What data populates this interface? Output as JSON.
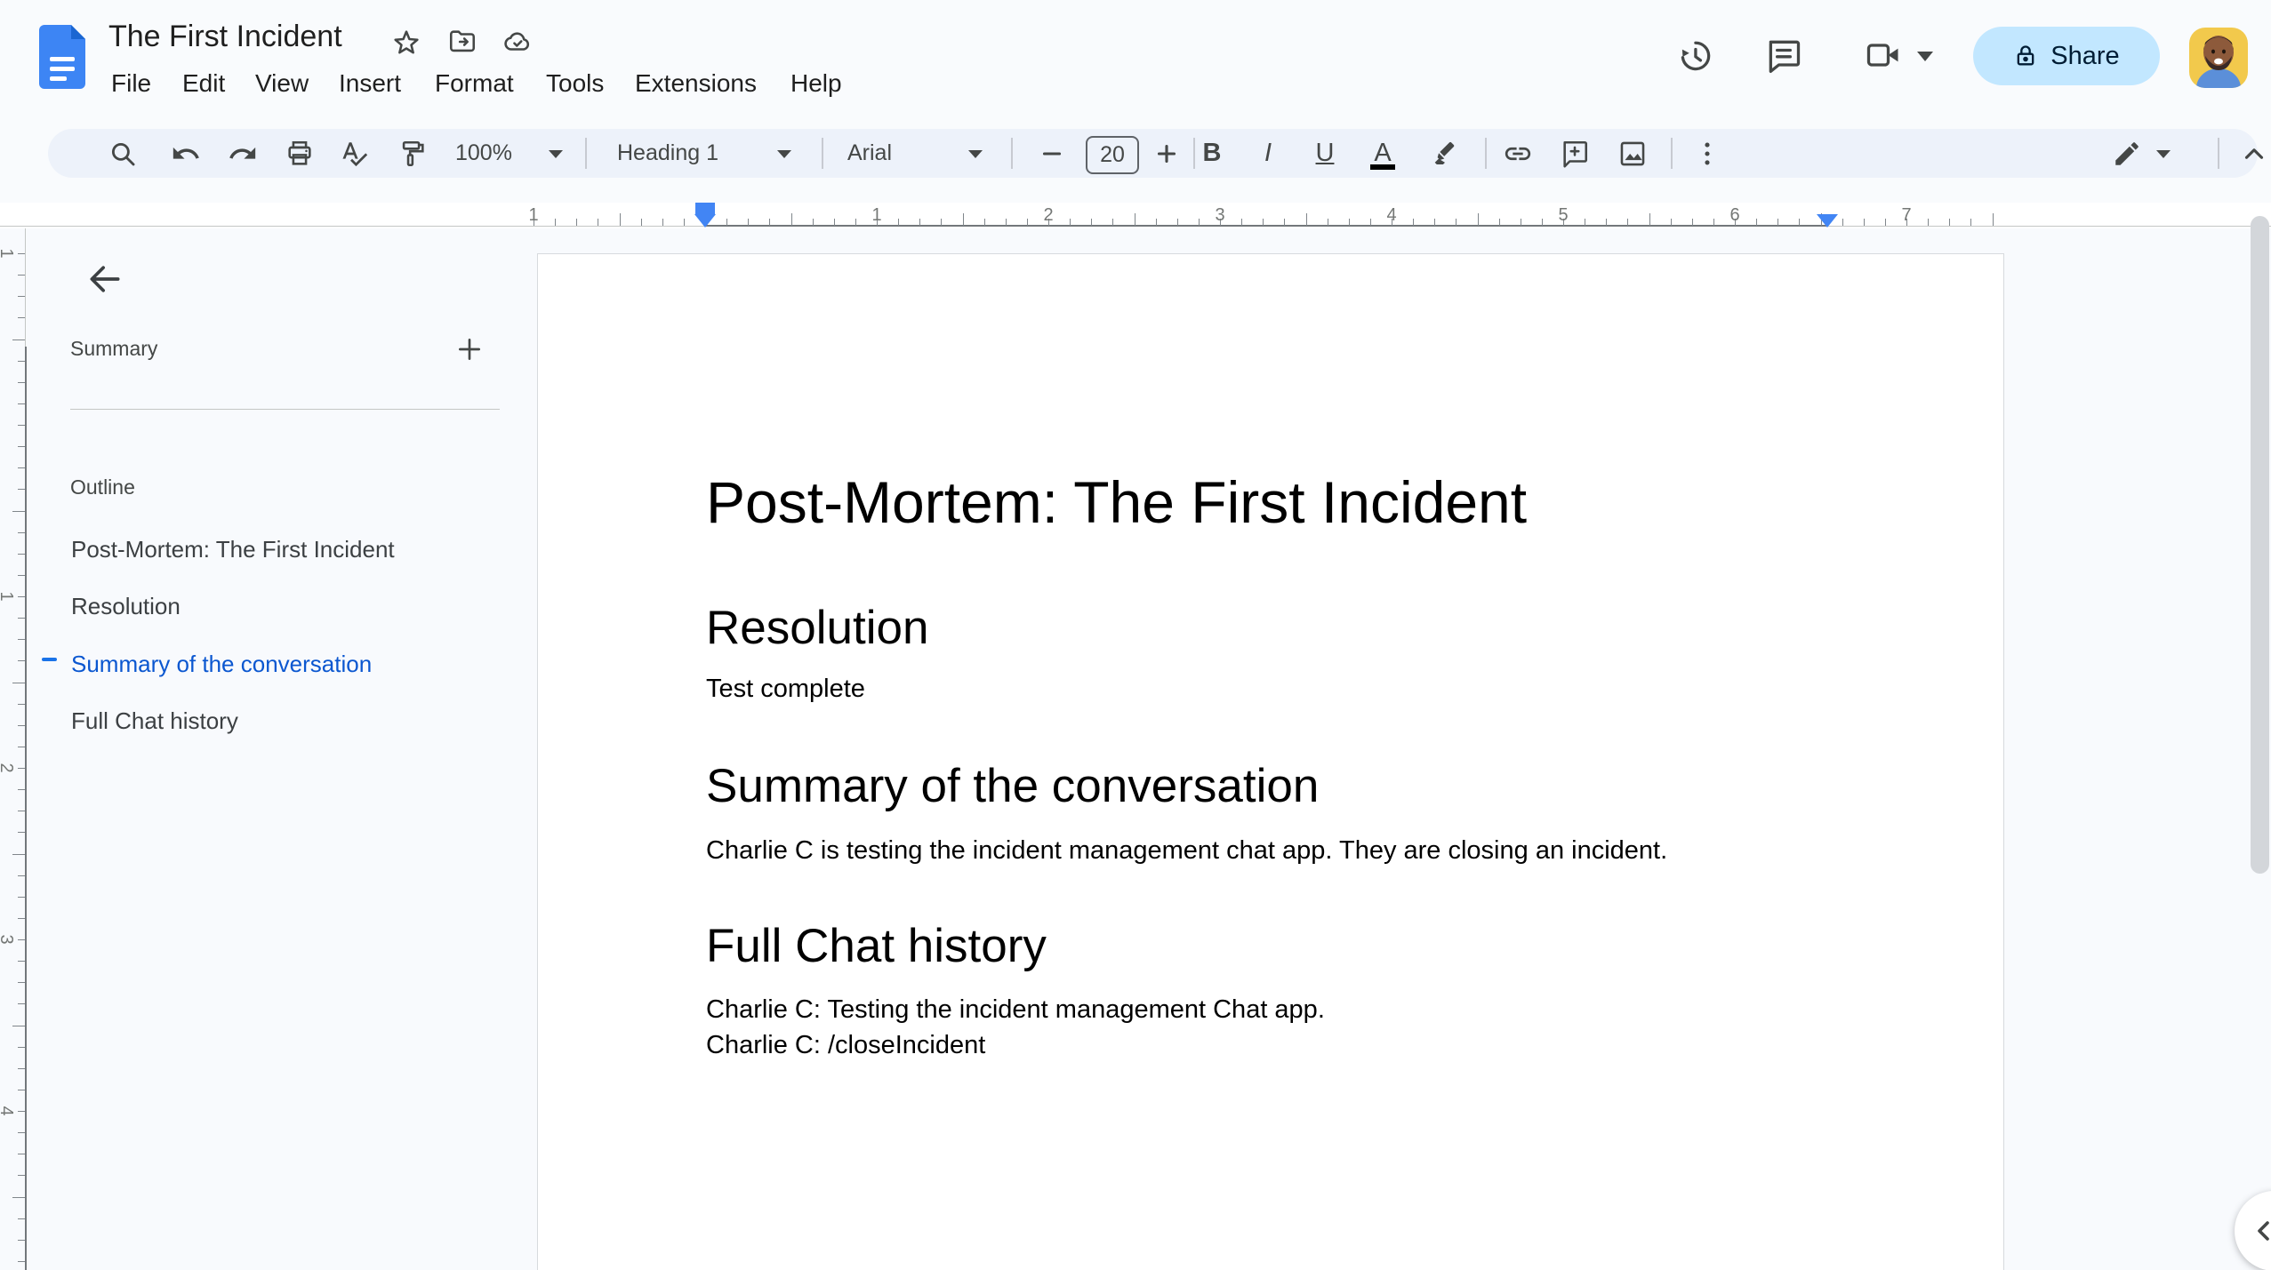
{
  "header": {
    "doc_title": "The First Incident",
    "menus": [
      "File",
      "Edit",
      "View",
      "Insert",
      "Format",
      "Tools",
      "Extensions",
      "Help"
    ],
    "share_label": "Share"
  },
  "toolbar": {
    "zoom": "100%",
    "paragraph_style": "Heading 1",
    "font_family": "Arial",
    "font_size": "20",
    "bold": "B",
    "italic": "I",
    "underline": "U",
    "text_color": "A"
  },
  "outline_panel": {
    "summary_label": "Summary",
    "outline_label": "Outline",
    "items": [
      {
        "label": "Post-Mortem: The First Incident",
        "active": false
      },
      {
        "label": "Resolution",
        "active": false
      },
      {
        "label": "Summary of the conversation",
        "active": true
      },
      {
        "label": "Full Chat history",
        "active": false
      }
    ]
  },
  "document": {
    "title": "Post-Mortem: The First Incident",
    "sections": [
      {
        "heading": "Resolution",
        "paragraphs": [
          "Test complete"
        ]
      },
      {
        "heading": "Summary of the conversation",
        "paragraphs": [
          "Charlie C is testing the incident management chat app. They are closing an incident."
        ]
      },
      {
        "heading": "Full Chat history",
        "paragraphs": [
          "Charlie C: Testing the incident management Chat app.",
          "Charlie C: /closeIncident"
        ]
      }
    ]
  },
  "rulers": {
    "horizontal": [
      "1",
      "1",
      "2",
      "3",
      "4",
      "5",
      "6",
      "7"
    ],
    "vertical": [
      "1",
      "1",
      "2",
      "3",
      "4"
    ]
  },
  "colors": {
    "accent_blue": "#0b57d0",
    "share_bg": "#c2e7ff",
    "toolbar_bg": "#edf2fa",
    "app_bg": "#f9fbfd"
  }
}
